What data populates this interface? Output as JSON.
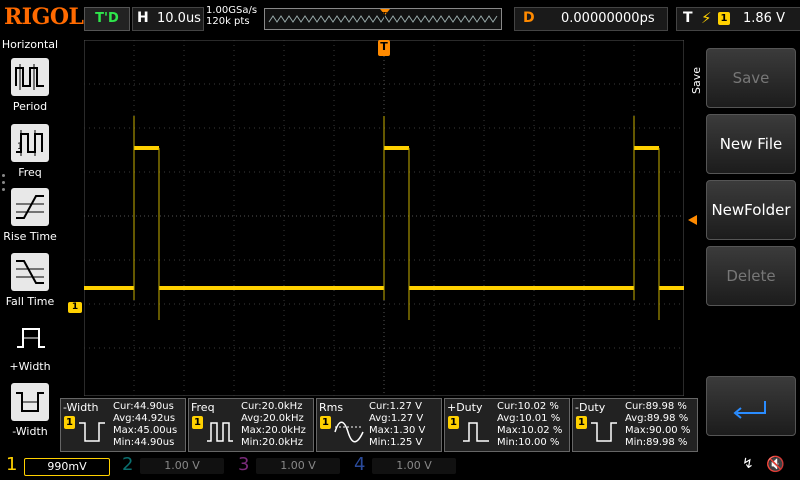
{
  "brand": {
    "logo": "RIGOL"
  },
  "status": {
    "run_state": "T'D"
  },
  "horizontal": {
    "label": "H",
    "timebase": "10.0us",
    "sample_rate": "1.00GSa/s",
    "memory_depth": "120k pts"
  },
  "delay": {
    "label": "D",
    "value": "0.00000000ps"
  },
  "trigger": {
    "label": "T",
    "source": "1",
    "level": "1.86 V"
  },
  "left_menu": {
    "title": "Horizontal",
    "items": [
      {
        "label": "Period",
        "icon": "period-icon"
      },
      {
        "label": "Freq",
        "icon": "freq-icon"
      },
      {
        "label": "Rise Time",
        "icon": "rise-time-icon"
      },
      {
        "label": "Fall Time",
        "icon": "fall-time-icon"
      },
      {
        "label": "+Width",
        "icon": "positive-width-icon"
      },
      {
        "label": "-Width",
        "icon": "negative-width-icon"
      }
    ]
  },
  "right_menu": {
    "title": "Save",
    "buttons": [
      {
        "label": "Save",
        "enabled": false
      },
      {
        "label": "New File",
        "enabled": true
      },
      {
        "label": "NewFolder",
        "enabled": true
      },
      {
        "label": "Delete",
        "enabled": false
      }
    ]
  },
  "markers": {
    "ch1": "1",
    "trigger_top": "T"
  },
  "measurements": [
    {
      "name": "-Width",
      "channel": "1",
      "cur": "Cur:44.90us",
      "avg": "Avg:44.92us",
      "max": "Max:45.00us",
      "min": "Min:44.90us"
    },
    {
      "name": "Freq",
      "channel": "1",
      "cur": "Cur:20.0kHz",
      "avg": "Avg:20.0kHz",
      "max": "Max:20.0kHz",
      "min": "Min:20.0kHz"
    },
    {
      "name": "Rms",
      "channel": "1",
      "cur": "Cur:1.27 V",
      "avg": "Avg:1.27 V",
      "max": "Max:1.30 V",
      "min": "Min:1.25 V"
    },
    {
      "name": "+Duty",
      "channel": "1",
      "cur": "Cur:10.02 %",
      "avg": "Avg:10.01 %",
      "max": "Max:10.02 %",
      "min": "Min:10.00 %"
    },
    {
      "name": "-Duty",
      "channel": "1",
      "cur": "Cur:89.98 %",
      "avg": "Avg:89.98 %",
      "max": "Max:90.00 %",
      "min": "Min:89.98 %"
    }
  ],
  "channels": [
    {
      "num": "1",
      "scale": "990mV",
      "color": "#ffd100",
      "active": true
    },
    {
      "num": "2",
      "scale": "1.00 V",
      "color": "#00c0c0",
      "active": false
    },
    {
      "num": "3",
      "scale": "1.00 V",
      "color": "#d040d0",
      "active": false
    },
    {
      "num": "4",
      "scale": "1.00 V",
      "color": "#3070ff",
      "active": false
    }
  ],
  "colors": {
    "brand": "#ff6a00",
    "channel1": "#ffd100",
    "trigger": "#ff8a00",
    "run": "#2ee64b"
  }
}
